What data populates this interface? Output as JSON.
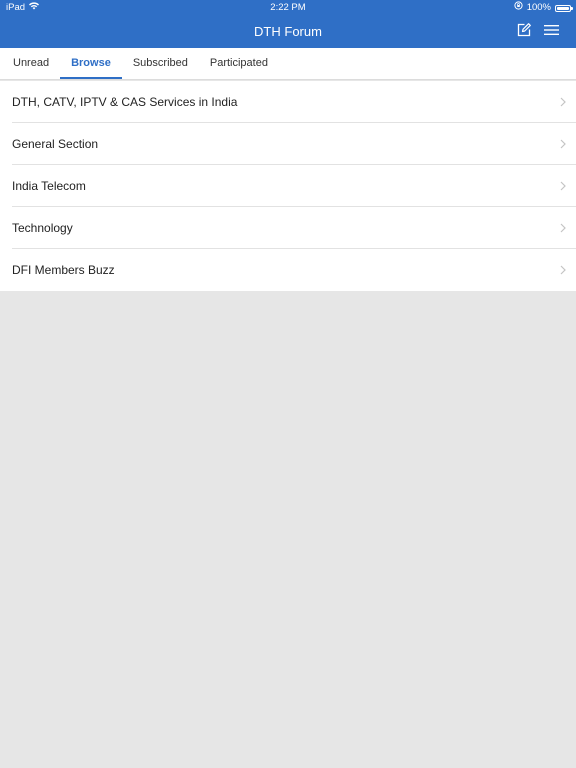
{
  "status_bar": {
    "device": "iPad",
    "time": "2:22 PM",
    "battery_text": "100%",
    "battery_level": 1.0
  },
  "nav": {
    "title": "DTH Forum",
    "compose_icon": "compose-icon",
    "menu_icon": "hamburger-menu-icon",
    "bar_color": "#2f6fc6"
  },
  "tabs": [
    {
      "label": "Unread",
      "active": false
    },
    {
      "label": "Browse",
      "active": true
    },
    {
      "label": "Subscribed",
      "active": false
    },
    {
      "label": "Participated",
      "active": false
    }
  ],
  "forums": [
    {
      "label": "DTH, CATV, IPTV & CAS Services in India"
    },
    {
      "label": "General Section"
    },
    {
      "label": "India Telecom"
    },
    {
      "label": "Technology"
    },
    {
      "label": "DFI Members Buzz"
    }
  ],
  "colors": {
    "accent": "#2f6fc6",
    "background": "#e6e6e6",
    "list_background": "#ffffff"
  }
}
